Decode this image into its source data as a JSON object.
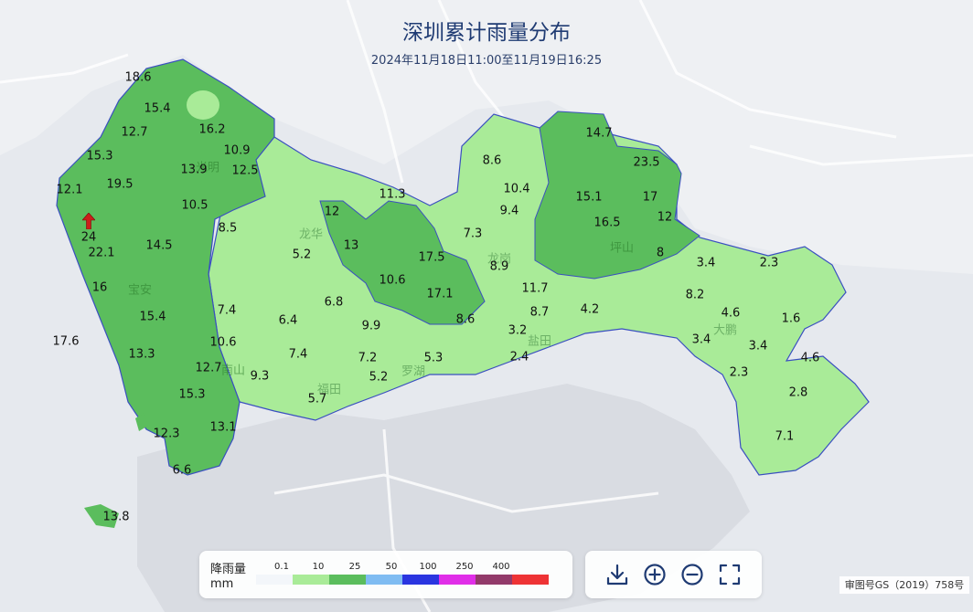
{
  "title": "深圳累计雨量分布",
  "subtitle": "2024年11月18日11:00至11月19日16:25",
  "districts": {
    "baoan": "宝安",
    "guangming": "光明",
    "longhua": "龙华",
    "longgang": "龙岗",
    "pingshan": "坪山",
    "dapeng": "大鹏",
    "nanshan": "南山",
    "futian": "福田",
    "luohu": "罗湖",
    "yantian": "盐田"
  },
  "rainfall_values": [
    "18.6",
    "15.4",
    "12.7",
    "16.2",
    "10.9",
    "12.5",
    "15.3",
    "13.9",
    "19.5",
    "12.1",
    "10.5",
    "8.5",
    "24",
    "22.1",
    "14.5",
    "16",
    "15.4",
    "17.6",
    "13.3",
    "10.6",
    "12.7",
    "15.3",
    "13.1",
    "12.3",
    "6.6",
    "13.8",
    "9.3",
    "7.4",
    "6.4",
    "7.4",
    "5.2",
    "6.8",
    "9.9",
    "7.2",
    "5.2",
    "5.7",
    "5.3",
    "12",
    "13",
    "11.3",
    "10.6",
    "17.5",
    "17.1",
    "8.6",
    "7.3",
    "8.9",
    "8.6",
    "10.4",
    "9.4",
    "11.7",
    "8.7",
    "3.2",
    "2.4",
    "4.2",
    "14.7",
    "23.5",
    "15.1",
    "17",
    "16.5",
    "12",
    "8",
    "3.4",
    "2.3",
    "8.2",
    "4.6",
    "1.6",
    "3.4",
    "3.4",
    "2.3",
    "4.6",
    "2.8",
    "7.1"
  ],
  "legend": {
    "title": "降雨量",
    "unit": "mm",
    "ticks": [
      "0.1",
      "10",
      "25",
      "50",
      "100",
      "250",
      "400"
    ],
    "colors": [
      "#f3f6fa",
      "#a9eb98",
      "#5bbd5d",
      "#7fbcf2",
      "#2a35e0",
      "#e02ee8",
      "#923a6a",
      "#ee3335"
    ]
  },
  "tools": {
    "download": "download-icon",
    "zoom_in": "zoom-in-icon",
    "zoom_out": "zoom-out-icon",
    "fullscreen": "fullscreen-icon"
  },
  "approval": "审图号GS（2019）758号"
}
